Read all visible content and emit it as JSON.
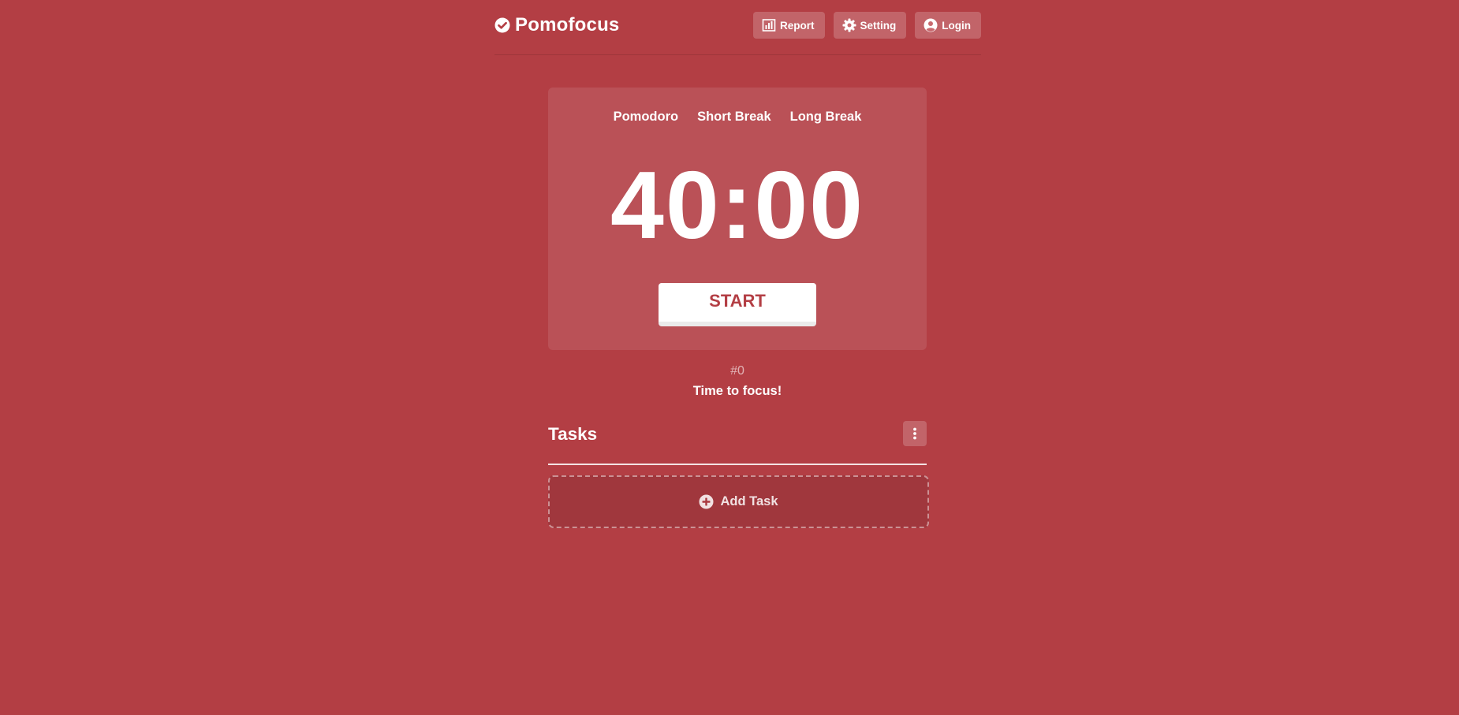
{
  "app": {
    "name": "Pomofocus",
    "logo_icon": "check-circle-icon"
  },
  "nav": {
    "report": {
      "label": "Report",
      "icon": "bar-chart-icon"
    },
    "setting": {
      "label": "Setting",
      "icon": "gear-icon"
    },
    "login": {
      "label": "Login",
      "icon": "user-circle-icon"
    }
  },
  "timer": {
    "modes": [
      "Pomodoro",
      "Short Break",
      "Long Break"
    ],
    "time": "40:00",
    "start_label": "START"
  },
  "session": {
    "count": "#0",
    "message": "Time to focus!"
  },
  "tasks": {
    "title": "Tasks",
    "menu_icon": "vertical-dots-icon",
    "add_label": "Add Task",
    "add_icon": "plus-circle-icon"
  },
  "colors": {
    "background": "#b33e44",
    "accent_text": "#b33e44",
    "white": "#ffffff"
  }
}
